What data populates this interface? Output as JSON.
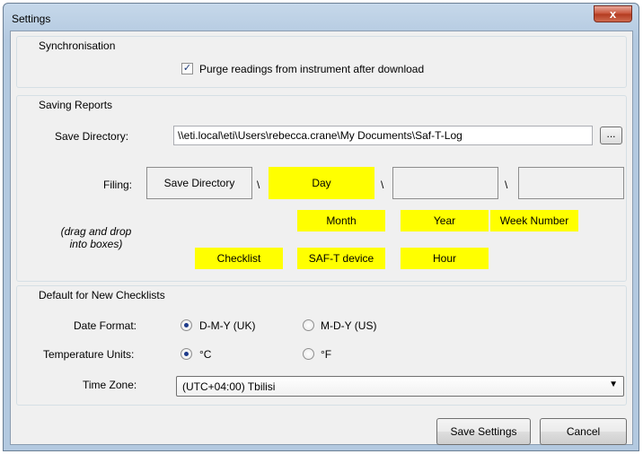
{
  "window": {
    "title": "Settings",
    "close_glyph": "x"
  },
  "synchronisation": {
    "title": "Synchronisation",
    "purge_checked": true,
    "purge_label": "Purge readings from instrument after download"
  },
  "saving_reports": {
    "title": "Saving Reports",
    "save_directory_label": "Save Directory:",
    "save_directory_value": "\\\\eti.local\\eti\\Users\\rebecca.crane\\My Documents\\Saf-T-Log",
    "browse_label": "...",
    "filing_label": "Filing:",
    "filing_boxes": [
      "Save Directory",
      "Day",
      "",
      ""
    ],
    "separator": "\\",
    "hint": "(drag and drop into boxes)",
    "chips": [
      "Month",
      "Year",
      "Week Number",
      "Checklist",
      "SAF-T device",
      "Hour"
    ]
  },
  "defaults": {
    "title": "Default for New Checklists",
    "date_format_label": "Date Format:",
    "date_options": [
      "D-M-Y (UK)",
      "M-D-Y (US)"
    ],
    "date_selected": "D-M-Y (UK)",
    "temperature_label": "Temperature Units:",
    "temperature_options": [
      "°C",
      "°F"
    ],
    "temperature_selected": "°C",
    "time_zone_label": "Time Zone:",
    "time_zone_value": "(UTC+04:00) Tbilisi"
  },
  "footer": {
    "save_label": "Save Settings",
    "cancel_label": "Cancel"
  },
  "icons": {
    "checkbox_checked": "check-icon",
    "dropdown": "chevron-down-icon"
  }
}
